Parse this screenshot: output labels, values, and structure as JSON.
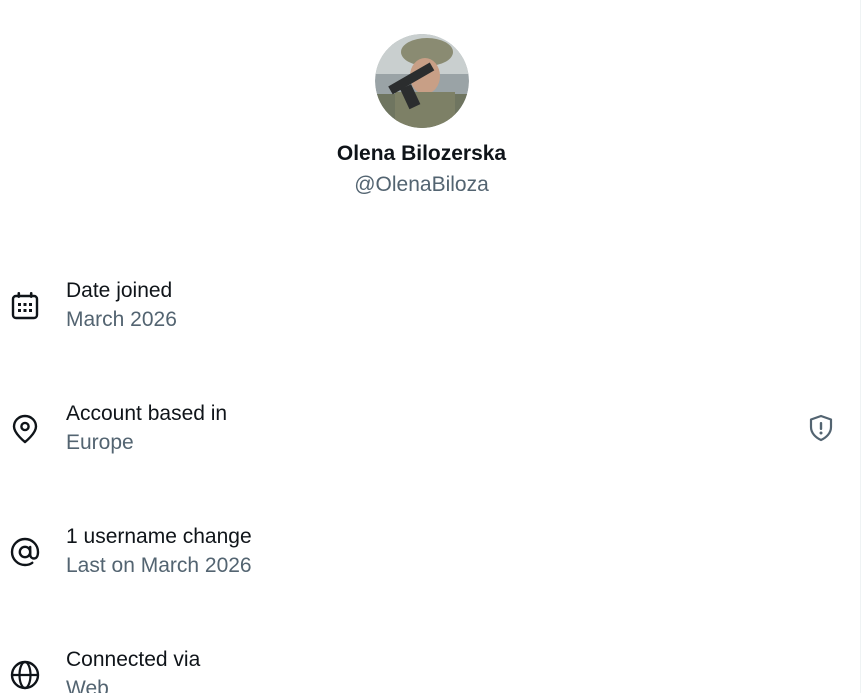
{
  "profile": {
    "name": "Olena Bilozerska",
    "handle": "@OlenaBiloza"
  },
  "rows": [
    {
      "label": "Date joined",
      "value": "March 2026",
      "icon": "calendar-icon"
    },
    {
      "label": "Account based in",
      "value": "Europe",
      "icon": "location-pin-icon",
      "side_icon": "shield-alert-icon"
    },
    {
      "label": "1 username change",
      "value": "Last on March 2026",
      "icon": "at-sign-icon"
    },
    {
      "label": "Connected via",
      "value": "Web",
      "icon": "globe-icon"
    }
  ],
  "colors": {
    "primary_text": "#0f1419",
    "secondary_text": "#536471"
  }
}
